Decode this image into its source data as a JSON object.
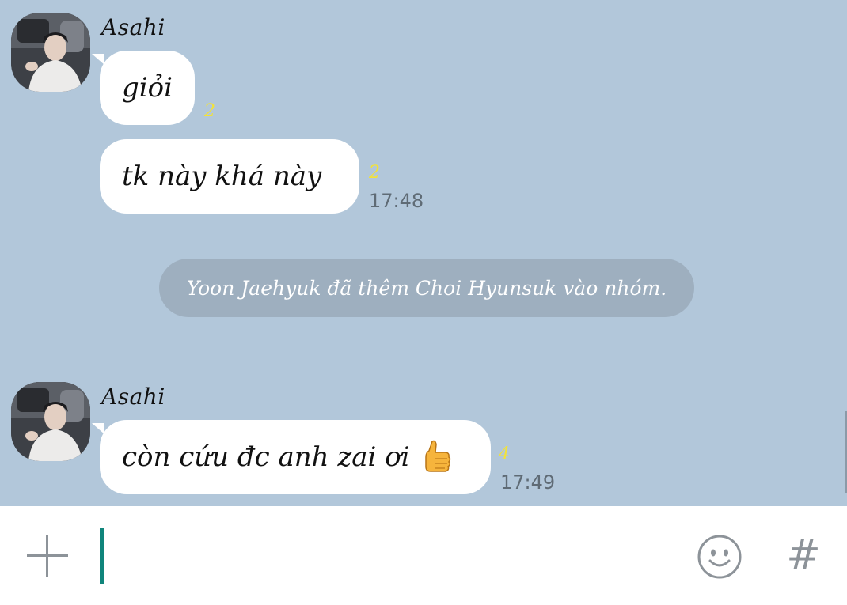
{
  "chat": {
    "messages_group_1": {
      "sender": "Asahi",
      "bubble_1": {
        "text": "giỏi",
        "read_count": "2"
      },
      "bubble_2": {
        "text": "tk này khá này",
        "read_count": "2",
        "time": "17:48"
      }
    },
    "system_notice": "Yoon Jaehyuk đã thêm Choi Hyunsuk vào nhóm.",
    "messages_group_2": {
      "sender": "Asahi",
      "bubble_1": {
        "text": "còn cứu đc anh zai ơi",
        "emoji": "thumbs-up",
        "read_count": "4",
        "time": "17:49"
      }
    }
  },
  "input_bar": {
    "text_value": "",
    "icons": {
      "plus": "plus-icon",
      "emoji": "smiley-icon",
      "hashtag": "hash-icon"
    },
    "hash_glyph": "#"
  },
  "colors": {
    "chat_background": "#b2c7da",
    "bubble": "#ffffff",
    "read_count": "#f2e23a",
    "system_pill": "#9eafbf",
    "caret": "#10857b"
  }
}
